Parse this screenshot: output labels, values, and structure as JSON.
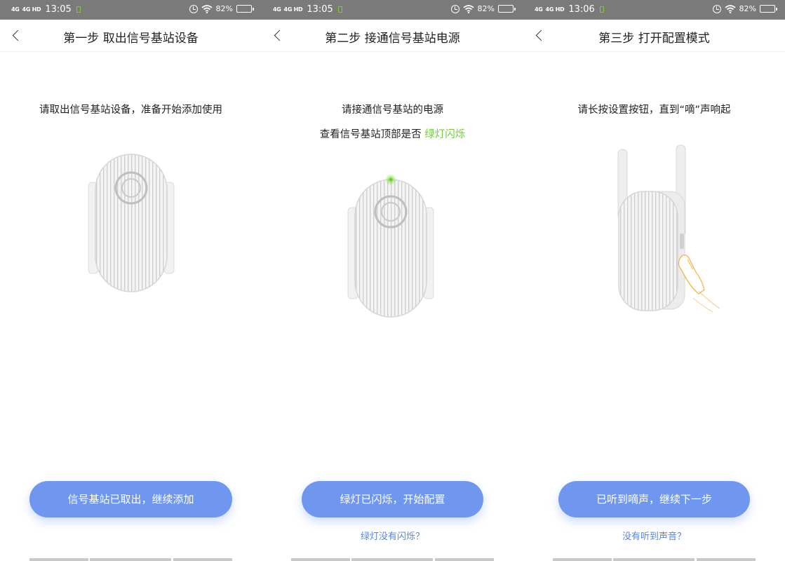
{
  "panels": [
    {
      "status": {
        "network": "4G",
        "network2": "4G HD",
        "time": "13:05",
        "battery": "82%"
      },
      "title": "第一步 取出信号基站设备",
      "instruction_1": "请取出信号基站设备，准备开始添加使用",
      "button": "信号基站已取出，继续添加"
    },
    {
      "status": {
        "network": "4G",
        "network2": "4G HD",
        "time": "13:05",
        "battery": "82%"
      },
      "title": "第二步 接通信号基站电源",
      "instruction_1": "请接通信号基站的电源",
      "instruction_2_prefix": "查看信号基站顶部是否",
      "instruction_2_highlight": "绿灯闪烁",
      "button": "绿灯已闪烁，开始配置",
      "link": "绿灯没有闪烁？"
    },
    {
      "status": {
        "network": "4G",
        "network2": "4G HD",
        "time": "13:06",
        "battery": "82%"
      },
      "title": "第三步 打开配置模式",
      "instruction_1": "请长按设置按钮，直到“嘀”声响起",
      "button": "已听到嘀声，继续下一步",
      "link": "没有听到声音？"
    }
  ],
  "colors": {
    "status_bar": "#7a7a7a",
    "accent_button": "#6f97f0",
    "link": "#5b86d8",
    "highlight_green": "#6fcf3a"
  },
  "icons": [
    "back-arrow-icon",
    "alarm-icon",
    "wifi-icon",
    "battery-icon",
    "signal-icon"
  ]
}
